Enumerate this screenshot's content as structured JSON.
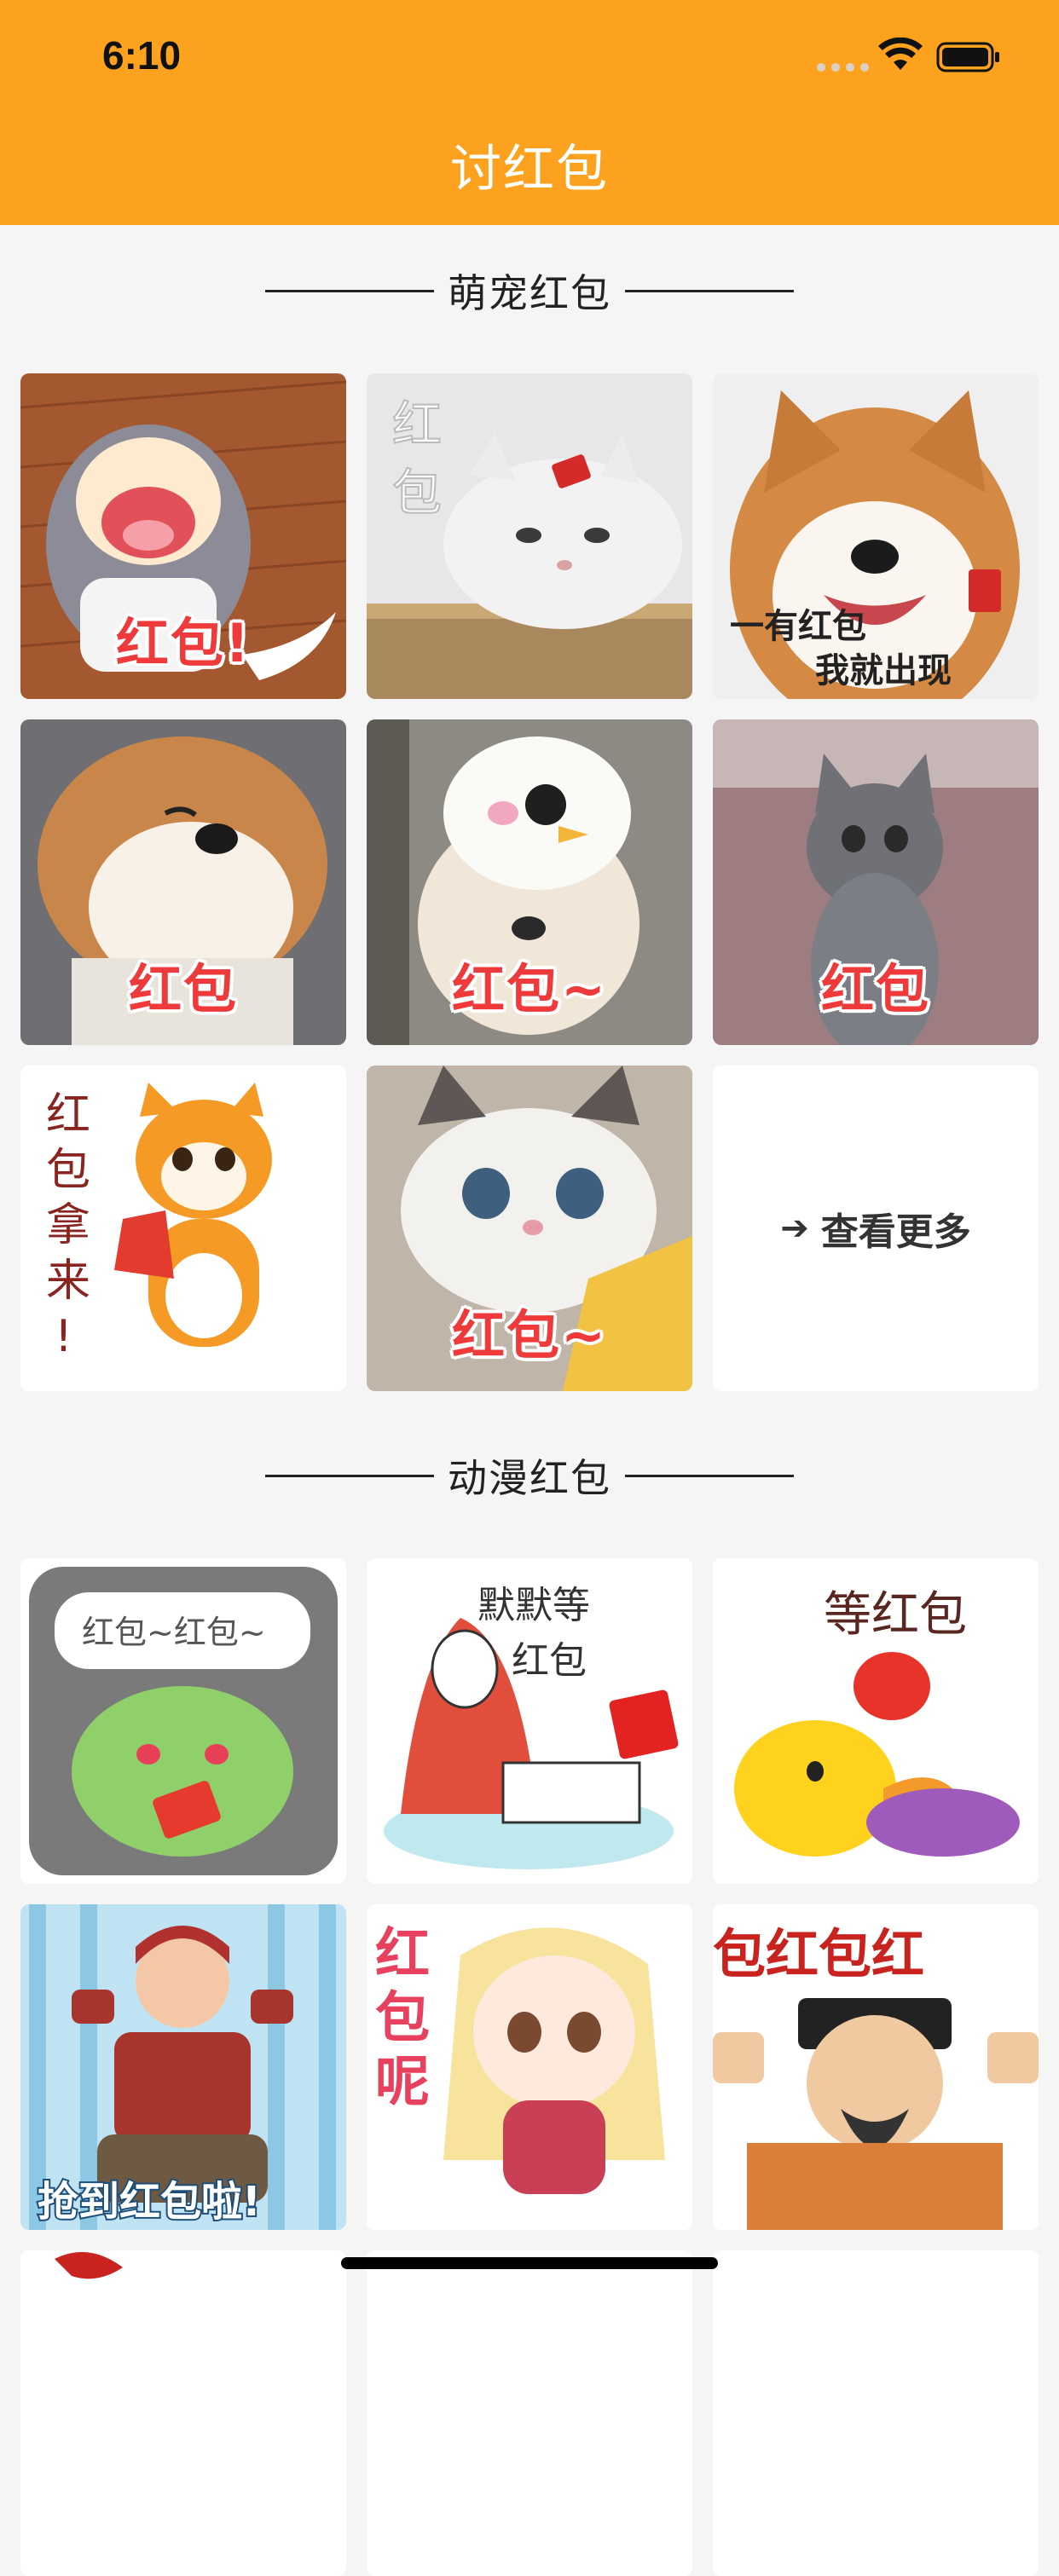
{
  "status_bar": {
    "time": "6:10"
  },
  "nav": {
    "title": "讨红包"
  },
  "sections": [
    {
      "title": "萌宠红包",
      "tiles": [
        {
          "caption": "红包!",
          "icon": "anime-girl-sticker"
        },
        {
          "caption": "红包",
          "icon": "white-cat-sticker"
        },
        {
          "caption": "一有红包我就出现",
          "icon": "shiba-dog-sticker"
        },
        {
          "caption": "红包",
          "icon": "smiling-shiba-sticker"
        },
        {
          "caption": "红包~",
          "icon": "dog-chicken-hat-sticker"
        },
        {
          "caption": "红包",
          "icon": "grey-cat-sticker"
        },
        {
          "caption": "红包拿来!",
          "icon": "cartoon-dog-sticker"
        },
        {
          "caption": "红包~",
          "icon": "ragdoll-cat-sticker"
        },
        {
          "caption": "查看更多",
          "icon": "arrow-right-icon"
        }
      ]
    },
    {
      "title": "动漫红包",
      "tiles": [
        {
          "caption": "红包~红包~",
          "icon": "green-monster-sticker"
        },
        {
          "caption": "默默等红包",
          "icon": "blanket-character-sticker"
        },
        {
          "caption": "等红包",
          "icon": "yellow-duck-sticker"
        },
        {
          "caption": "抢到红包啦!",
          "icon": "anime-warrior-sticker"
        },
        {
          "caption": "红包呢",
          "icon": "blonde-anime-girl-sticker"
        },
        {
          "caption": "红包红包红",
          "icon": "emperor-sticker"
        }
      ]
    }
  ],
  "colors": {
    "header": "#FDA21E",
    "background": "#F5F5F5",
    "caption_red": "#EE3A3A"
  }
}
